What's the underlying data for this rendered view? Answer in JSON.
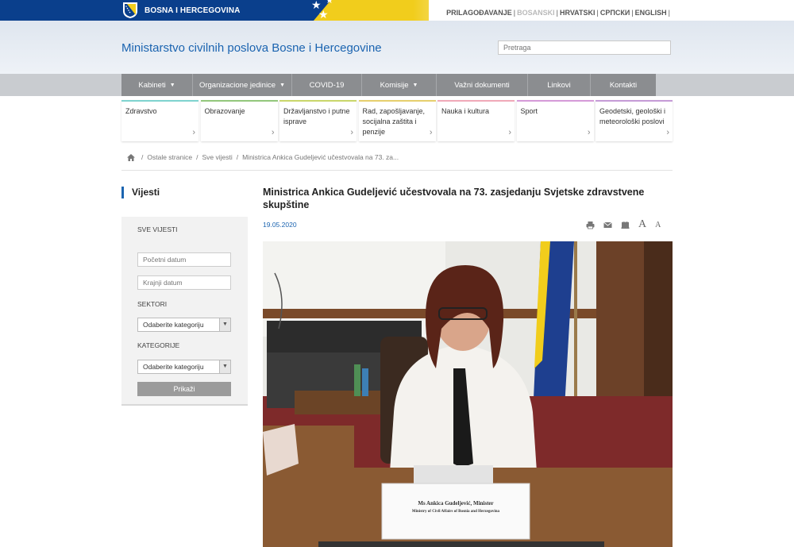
{
  "topbar": {
    "country": "BOSNA I HERCEGOVINA",
    "languages": [
      {
        "label": "PRILAGOĐAVANJE",
        "active": false
      },
      {
        "label": "BOSANSKI",
        "active": true
      },
      {
        "label": "HRVATSKI",
        "active": false
      },
      {
        "label": "СРПСКИ",
        "active": false
      },
      {
        "label": "ENGLISH",
        "active": false
      }
    ]
  },
  "header": {
    "ministry_name": "Ministarstvo civilnih poslova Bosne i Hercegovine",
    "search_placeholder": "Pretraga"
  },
  "nav": [
    {
      "label": "Kabineti",
      "has_dropdown": true
    },
    {
      "label": "Organizacione jedinice",
      "has_dropdown": true
    },
    {
      "label": "COVID-19",
      "has_dropdown": false
    },
    {
      "label": "Komisije",
      "has_dropdown": true
    },
    {
      "label": "Važni dokumenti",
      "has_dropdown": false
    },
    {
      "label": "Linkovi",
      "has_dropdown": false
    },
    {
      "label": "Kontakti",
      "has_dropdown": false
    }
  ],
  "sectors": [
    {
      "label": "Zdravstvo",
      "color": "#7fd3cf"
    },
    {
      "label": "Obrazovanje",
      "color": "#93c77c"
    },
    {
      "label": "Državljanstvo i putne isprave",
      "color": "#c9d66b"
    },
    {
      "label": "Rad, zapošljavanje, socijalna zaštita i penzije",
      "color": "#e6cf6e"
    },
    {
      "label": "Nauka i kultura",
      "color": "#f0a9b8"
    },
    {
      "label": "Sport",
      "color": "#d59ad8"
    },
    {
      "label": "Geodetski, geološki i meteorološki poslovi",
      "color": "#c59bd6"
    }
  ],
  "breadcrumb": [
    "Ostale stranice",
    "Sve vijesti",
    "Ministrica Ankica Gudeljević učestvovala na 73. za..."
  ],
  "sidebar": {
    "title": "Vijesti",
    "all_news": "SVE VIJESTI",
    "start_date_placeholder": "Početni datum",
    "end_date_placeholder": "Krajnji datum",
    "sectors_label": "SEKTORI",
    "sectors_select": "Odaberite kategoriju",
    "categories_label": "KATEGORIJE",
    "categories_select": "Odaberite kategoriju",
    "show_button": "Prikaži"
  },
  "article": {
    "title": "Ministrica Ankica Gudeljević učestvovala na 73. zasjedanju Svjetske zdravstvene skupštine",
    "date": "19.05.2020",
    "tools": [
      "print-icon",
      "email-icon",
      "pdf-icon",
      "font-increase-icon",
      "font-decrease-icon"
    ],
    "font_large": "A",
    "font_small": "A",
    "nameplate_line1": "Ms Ankica Gudeljević, Minister",
    "nameplate_line2": "Ministry of Civil Affairs of Bosnia and Herzegovina"
  }
}
